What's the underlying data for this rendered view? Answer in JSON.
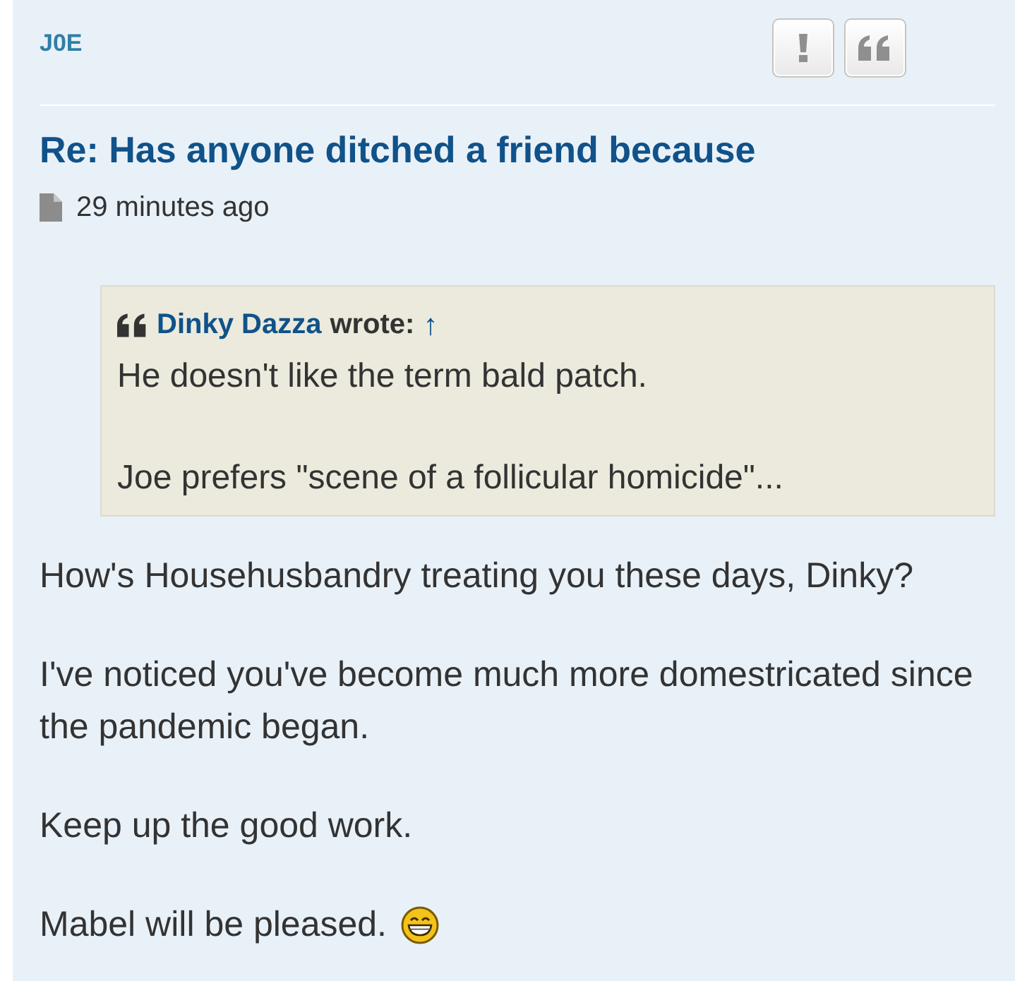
{
  "post": {
    "author": "J0E",
    "buttons": [
      {
        "kind": "report"
      },
      {
        "kind": "quote"
      }
    ],
    "title": "Re: Has anyone ditched a friend because",
    "time": "29 minutes ago",
    "quote": {
      "author": "Dinky Dazza",
      "wrote": "wrote:",
      "jump": "↑",
      "paragraphs": [
        "He doesn't like the term bald patch.",
        "Joe prefers \"scene of a follicular homicide\"..."
      ]
    },
    "body": [
      "How's Househusbandry treating you these days, Dinky?",
      "I've noticed you've become much more domestricated since the pandemic began.",
      "Keep up the good work.",
      "Mabel will be pleased."
    ]
  }
}
